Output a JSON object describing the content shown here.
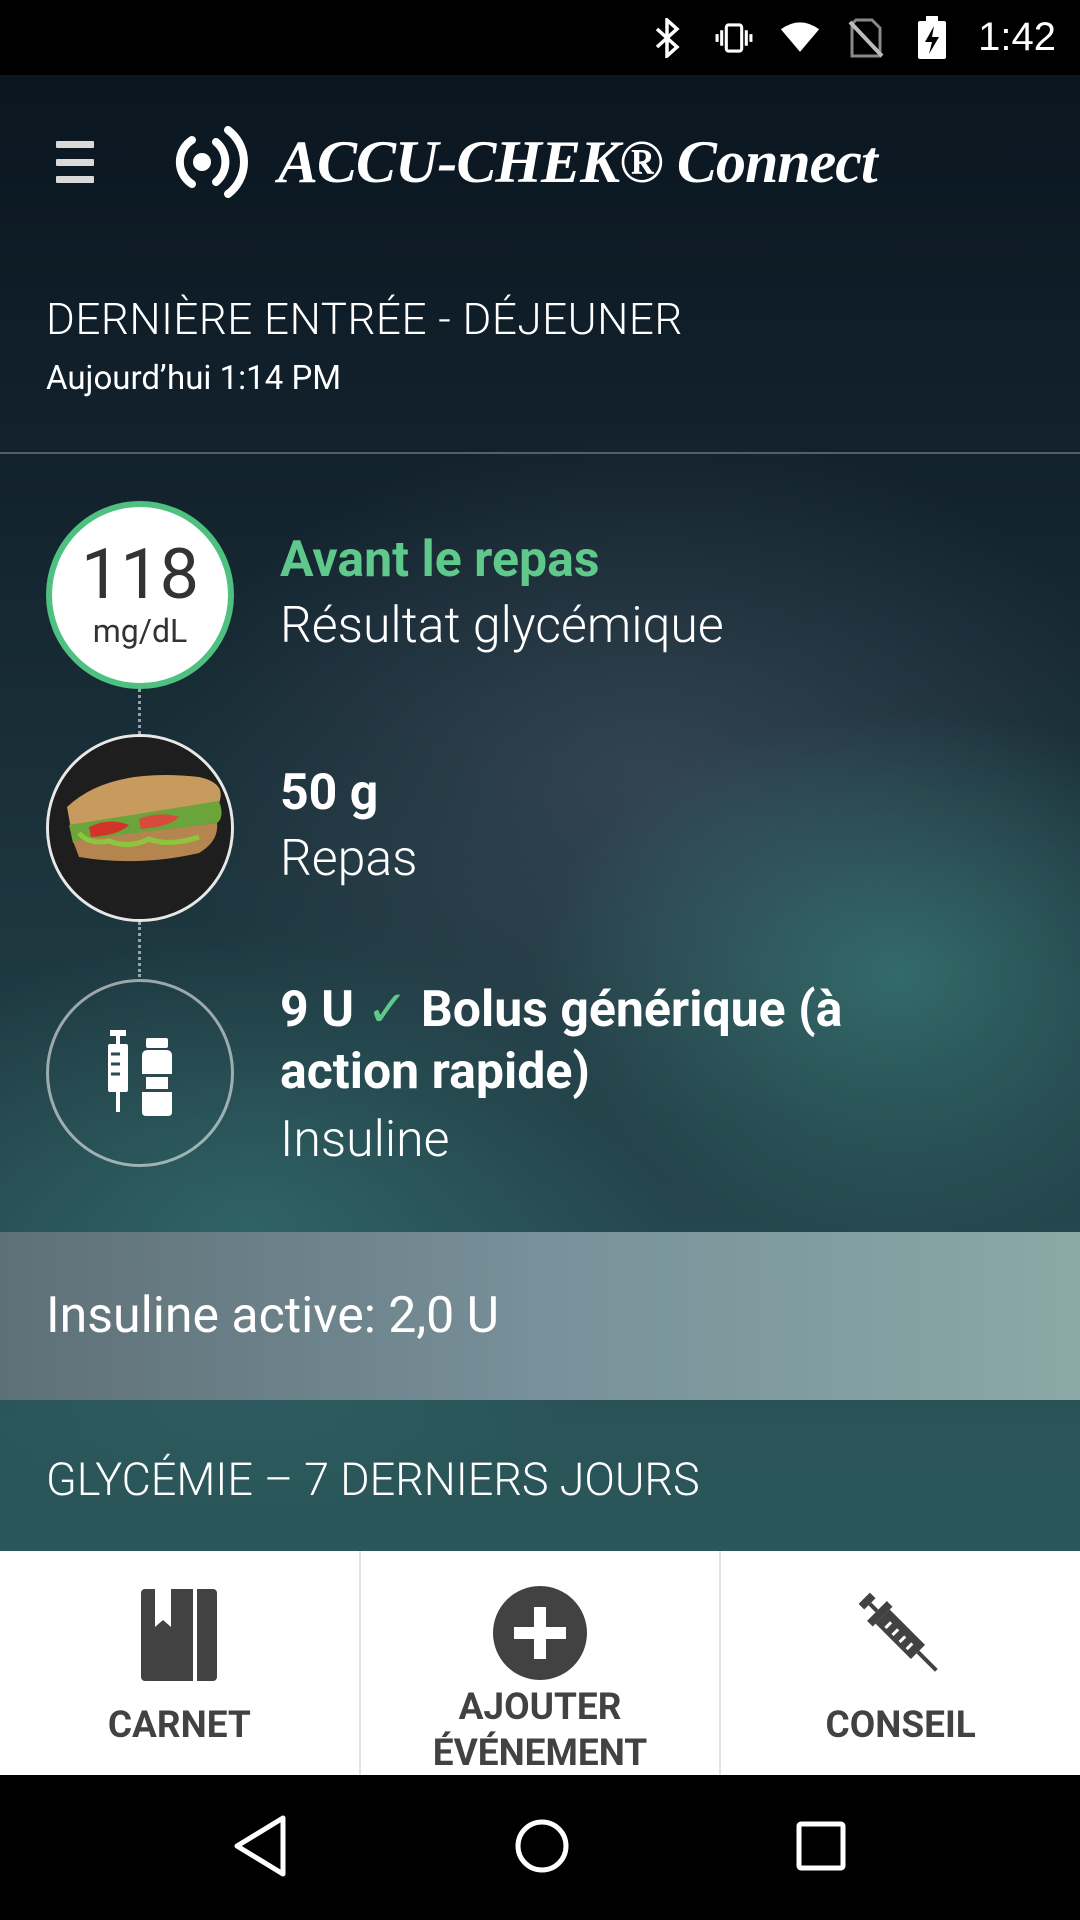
{
  "status_bar": {
    "time": "1:42",
    "icons": [
      "bluetooth-icon",
      "vibrate-icon",
      "wifi-icon",
      "no-sim-icon",
      "battery-charging-icon"
    ]
  },
  "header": {
    "menu_icon": "hamburger-menu-icon",
    "logo_text": "ACCU-CHEK® Connect"
  },
  "last_entry": {
    "title": "DERNIÈRE ENTRÉE - DÉJEUNER",
    "subtitle": "Aujourd’hui 1:14 PM"
  },
  "entries": {
    "glucose": {
      "value": "118",
      "unit": "mg/dL",
      "primary": "Avant le repas",
      "secondary": "Résultat glycémique",
      "accent_color": "#5ec98b"
    },
    "meal": {
      "primary": "50 g",
      "secondary": "Repas",
      "image": "sandwich-photo"
    },
    "insulin": {
      "amount": "9 U",
      "check": "✓",
      "name_line1": "Bolus générique (à",
      "name_line2": "action rapide)",
      "secondary": "Insuline",
      "icon": "syringe-vial-icon"
    }
  },
  "active_insulin": "Insuline active: 2,0 U",
  "section_title": "GLYCÉMIE – 7 DERNIERS JOURS",
  "bottom_nav": {
    "items": [
      {
        "label": "CARNET",
        "icon": "logbook-icon"
      },
      {
        "label_line1": "AJOUTER",
        "label_line2": "ÉVÉNEMENT",
        "icon": "add-circle-icon"
      },
      {
        "label": "CONSEIL",
        "icon": "syringe-icon"
      }
    ]
  },
  "system_nav": {
    "icons": [
      "back-icon",
      "home-icon",
      "recents-icon"
    ]
  }
}
